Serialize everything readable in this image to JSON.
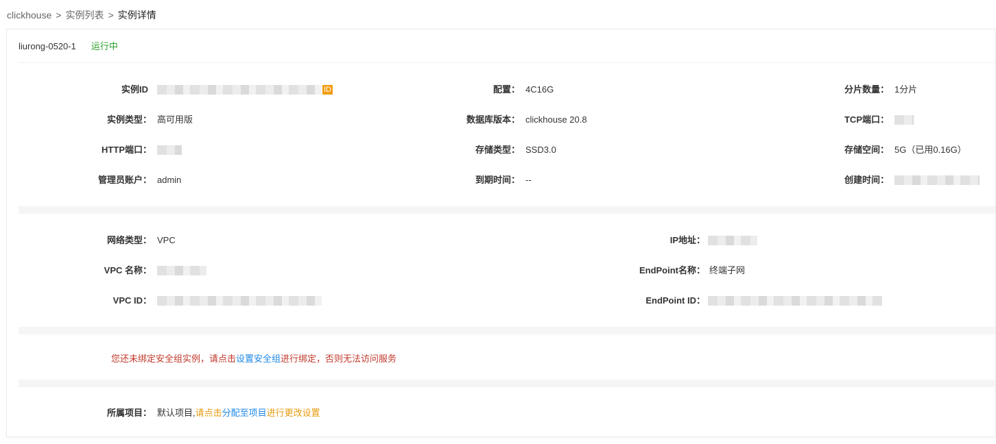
{
  "breadcrumb": {
    "items": [
      "clickhouse",
      "实例列表",
      "实例详情"
    ],
    "separator": ">"
  },
  "header": {
    "name": "liurong-0520-1",
    "status": "运行中",
    "status_color": "#2c9f2c"
  },
  "basic": {
    "instance_id": {
      "label": "实例ID",
      "badge": "ID"
    },
    "config": {
      "label": "配置：",
      "value": "4C16G"
    },
    "shards": {
      "label": "分片数量：",
      "value": "1分片"
    },
    "instance_type": {
      "label": "实例类型：",
      "value": "高可用版"
    },
    "db_version": {
      "label": "数据库版本：",
      "value": "clickhouse 20.8"
    },
    "tcp_port": {
      "label": "TCP端口："
    },
    "http_port": {
      "label": "HTTP端口："
    },
    "storage_type": {
      "label": "存储类型：",
      "value": "SSD3.0"
    },
    "storage_space": {
      "label": "存储空间：",
      "value": "5G（已用0.16G）"
    },
    "admin_account": {
      "label": "管理员账户：",
      "value": "admin"
    },
    "expire_time": {
      "label": "到期时间：",
      "value": "--"
    },
    "create_time": {
      "label": "创建时间："
    }
  },
  "network": {
    "net_type": {
      "label": "网络类型：",
      "value": "VPC"
    },
    "ip": {
      "label": "IP地址："
    },
    "vpc_name": {
      "label": "VPC 名称："
    },
    "endpoint_name": {
      "label": "EndPoint名称：",
      "value": "终端子网"
    },
    "vpc_id": {
      "label": "VPC ID："
    },
    "endpoint_id": {
      "label": "EndPoint ID："
    }
  },
  "security": {
    "text_before": "您还未绑定安全组实例，请点击",
    "link": "设置安全组",
    "text_after": "进行绑定，否则无法访问服务",
    "color": "#c0392b",
    "link_color": "#1e88e5"
  },
  "project": {
    "label": "所属项目：",
    "value": "默认项目,",
    "hint_before": "请点击",
    "link": "分配至项目",
    "hint_after": "进行更改设置",
    "hint_color": "#e69c10"
  }
}
